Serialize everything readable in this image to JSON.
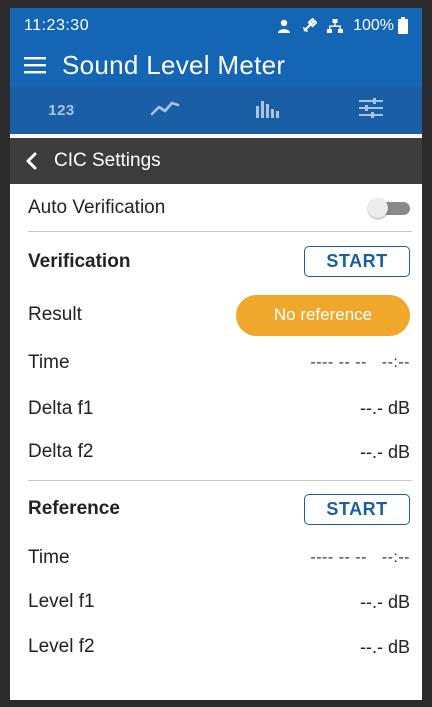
{
  "status_bar": {
    "time": "11:23:30",
    "icons": [
      "person-icon",
      "satellite-icon",
      "network-icon",
      "battery-icon"
    ],
    "battery": "100%"
  },
  "app_bar": {
    "title": "Sound Level Meter"
  },
  "tabs": [
    {
      "label": "123",
      "icon": "numeric-tab"
    },
    {
      "icon": "trend-line-icon"
    },
    {
      "icon": "bar-spectrum-icon"
    },
    {
      "icon": "sliders-icon"
    }
  ],
  "sub_header": {
    "title": "CIC Settings"
  },
  "auto_verification": {
    "label": "Auto Verification",
    "enabled": false
  },
  "verification": {
    "heading": "Verification",
    "start_label": "START",
    "result_label": "Result",
    "result_value": "No reference",
    "time_label": "Time",
    "time_value": "---- -- --   --:--",
    "delta_f1_label": "Delta f1",
    "delta_f1_value": "--.- dB",
    "delta_f2_label": "Delta f2",
    "delta_f2_value": "--.- dB"
  },
  "reference": {
    "heading": "Reference",
    "start_label": "START",
    "time_label": "Time",
    "time_value": "---- -- --   --:--",
    "level_f1_label": "Level f1",
    "level_f1_value": "--.- dB",
    "level_f2_label": "Level f2",
    "level_f2_value": "--.- dB"
  },
  "colors": {
    "header_blue": "#1565b5",
    "subheader_gray": "#3c3c3c",
    "badge_orange": "#f0a82c",
    "button_blue": "#1a5ea6"
  }
}
